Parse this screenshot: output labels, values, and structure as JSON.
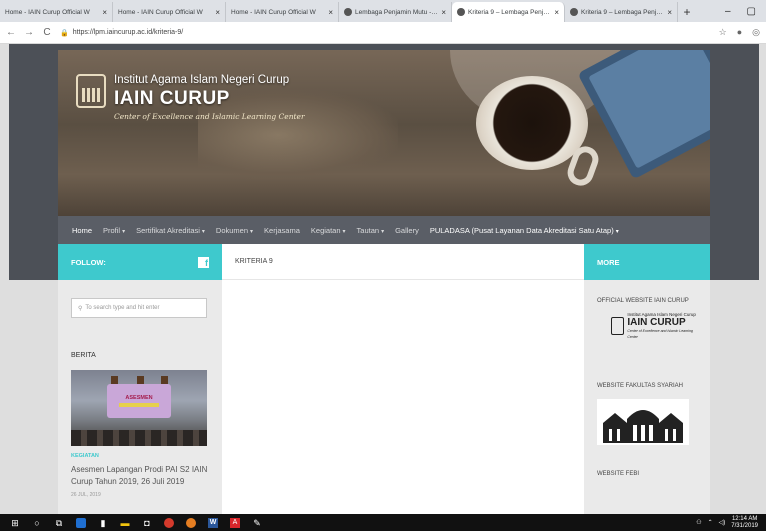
{
  "browser": {
    "tabs": [
      {
        "title": "Home - IAIN Curup Official W",
        "favicon": "iain-favicon-icon"
      },
      {
        "title": "Home - IAIN Curup Official W",
        "favicon": "iain-favicon-icon"
      },
      {
        "title": "Home - IAIN Curup Official W",
        "favicon": "iain-favicon-icon"
      },
      {
        "title": "Lembaga Penjamin Mutu - LP",
        "favicon": "globe-icon"
      },
      {
        "title": "Kriteria 9 – Lembaga Penjamin",
        "favicon": "globe-icon",
        "active": true
      },
      {
        "title": "Kriteria 9 – Lembaga Penjamin",
        "favicon": "globe-icon"
      }
    ],
    "url": "https://lpm.iaincurup.ac.id/kriteria-9/"
  },
  "header": {
    "institution": "Institut Agama Islam Negeri Curup",
    "name": "IAIN CURUP",
    "tagline": "Center of Excellence and Islamic Learning Center"
  },
  "nav": {
    "items": [
      {
        "label": "Home",
        "dropdown": false
      },
      {
        "label": "Profil",
        "dropdown": true
      },
      {
        "label": "Sertifikat Akreditasi",
        "dropdown": true
      },
      {
        "label": "Dokumen",
        "dropdown": true
      },
      {
        "label": "Kerjasama",
        "dropdown": false
      },
      {
        "label": "Kegiatan",
        "dropdown": true
      },
      {
        "label": "Tautan",
        "dropdown": true
      },
      {
        "label": "Gallery",
        "dropdown": false
      },
      {
        "label": "PULADASA (Pusat Layanan Data Akreditasi Satu Atap)",
        "dropdown": true
      }
    ]
  },
  "sidebar_left": {
    "follow_label": "FOLLOW:",
    "search_placeholder": "To search type and hit enter",
    "section_title": "BERITA",
    "post": {
      "banner_text": "ASESMEN",
      "category": "KEGIATAN",
      "title": "Asesmen Lapangan Prodi PAI S2 IAIN Curup Tahun 2019, 26 Juli 2019",
      "date": "26 JUL, 2019"
    }
  },
  "main": {
    "title": "KRITERIA 9"
  },
  "sidebar_right": {
    "more_label": "MORE",
    "sections": [
      {
        "title": "OFFICIAL WEBSITE IAIN CURUP",
        "logo_line1": "Institut Agama Islam Negeri Curup",
        "logo_line2": "IAIN CURUP",
        "logo_line3": "Center of Excellence and Islamic Learning Center"
      },
      {
        "title": "WEBSITE FAKULTAS SYARIAH"
      },
      {
        "title": "WEBSITE FEBI"
      }
    ]
  },
  "taskbar": {
    "time": "12:14 AM",
    "date": "7/31/2019"
  },
  "colors": {
    "accent": "#3ec9cd",
    "nav_bg": "#5a5e66",
    "page_bg": "#dedede"
  }
}
